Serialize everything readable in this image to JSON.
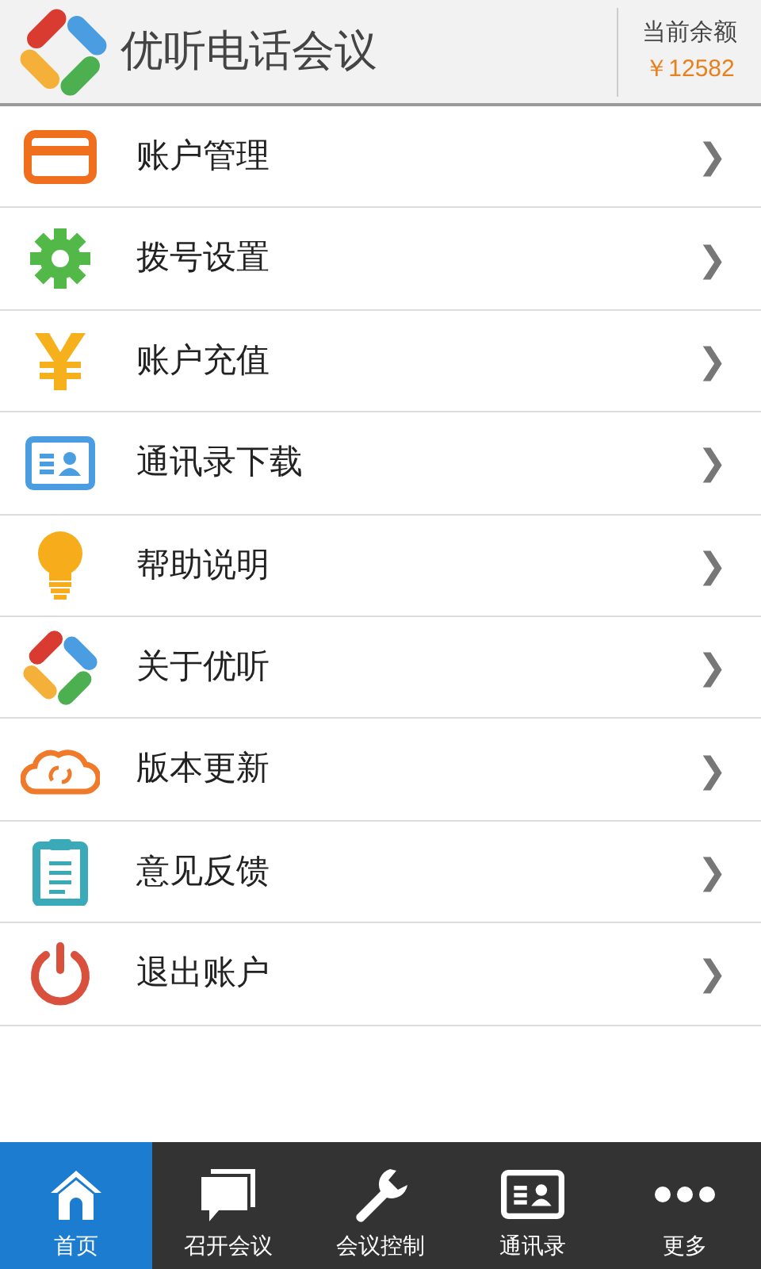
{
  "header": {
    "title": "优听电话会议",
    "balance_label": "当前余额",
    "balance": "￥12582"
  },
  "menu": [
    {
      "kind": "card",
      "label": "账户管理",
      "arrow": "❯"
    },
    {
      "kind": "gear",
      "label": "拨号设置",
      "arrow": "❯"
    },
    {
      "kind": "yen",
      "label": "账户充值",
      "arrow": "❯"
    },
    {
      "kind": "contact",
      "label": "通讯录下载",
      "arrow": "❯"
    },
    {
      "kind": "bulb",
      "label": "帮助说明",
      "arrow": "❯"
    },
    {
      "kind": "logo",
      "label": "关于优听",
      "arrow": "❯"
    },
    {
      "kind": "cloud",
      "label": "版本更新",
      "arrow": "❯"
    },
    {
      "kind": "clipboard",
      "label": "意见反馈",
      "arrow": "❯"
    },
    {
      "kind": "power",
      "label": "退出账户",
      "arrow": "❯"
    }
  ],
  "tabs": [
    {
      "kind": "home",
      "label": "首页",
      "selected": true
    },
    {
      "kind": "chat",
      "label": "召开会议",
      "selected": false
    },
    {
      "kind": "wrench",
      "label": "会议控制",
      "selected": false
    },
    {
      "kind": "contact",
      "label": "通讯录",
      "selected": false
    },
    {
      "kind": "more",
      "label": "更多",
      "selected": false
    }
  ]
}
